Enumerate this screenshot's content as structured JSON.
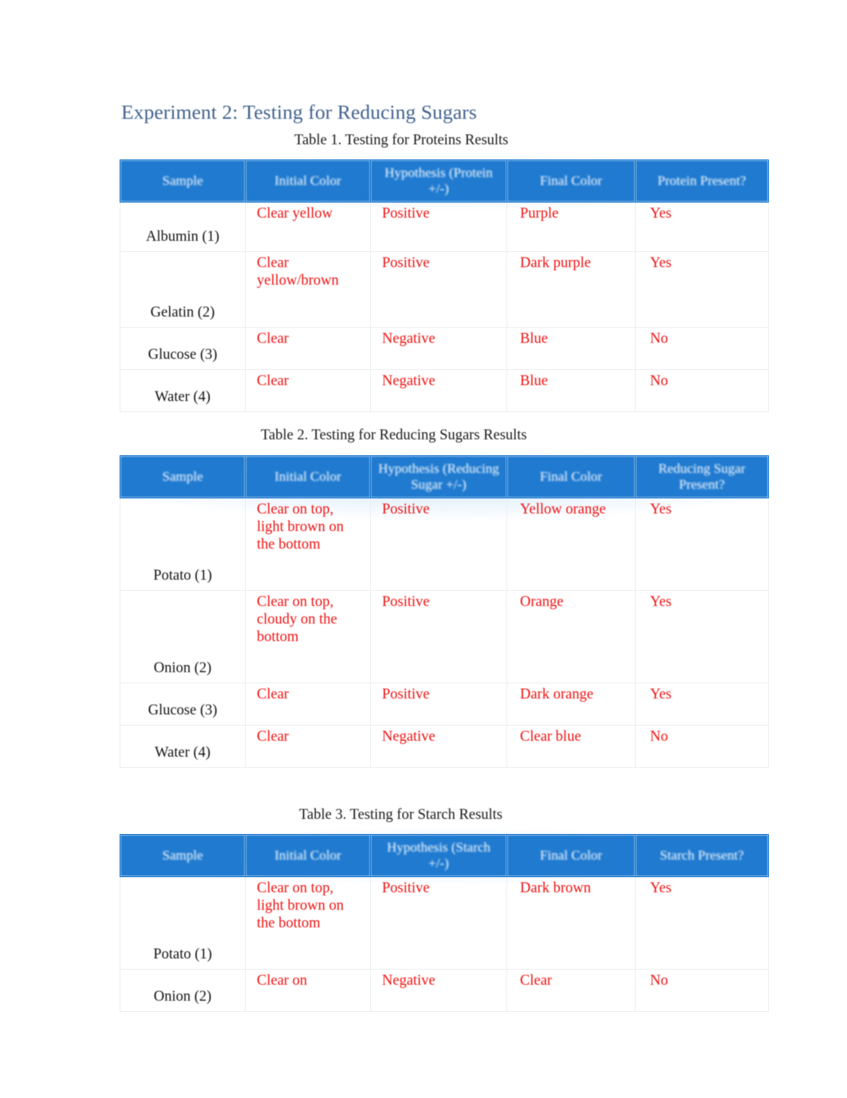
{
  "document": {
    "title": "Experiment 2: Testing for Reducing Sugars",
    "title_color": "#41628f",
    "header_bg_color": "#1f7ad0",
    "value_text_color": "#ee1111",
    "sample_text_color": "#131313"
  },
  "tables": [
    {
      "caption": "Table 1. Testing for Proteins Results",
      "headers": [
        "Sample",
        "Initial Color",
        "Hypothesis (Protein +/-)",
        "Final Color",
        "Protein Present?"
      ],
      "rows": [
        {
          "sample": "Albumin (1)",
          "initial_color": "Clear yellow",
          "hypothesis": "Positive",
          "final_color": "Purple",
          "present": "Yes"
        },
        {
          "sample": "Gelatin (2)",
          "initial_color": "Clear yellow/brown",
          "hypothesis": "Positive",
          "final_color": "Dark purple",
          "present": "Yes"
        },
        {
          "sample": "Glucose (3)",
          "initial_color": "Clear",
          "hypothesis": "Negative",
          "final_color": "Blue",
          "present": "No"
        },
        {
          "sample": "Water (4)",
          "initial_color": "Clear",
          "hypothesis": "Negative",
          "final_color": "Blue",
          "present": "No"
        }
      ]
    },
    {
      "caption": "Table 2. Testing for Reducing Sugars Results",
      "headers": [
        "Sample",
        "Initial Color",
        "Hypothesis (Reducing Sugar +/-)",
        "Final Color",
        "Reducing Sugar Present?"
      ],
      "rows": [
        {
          "sample": "Potato (1)",
          "initial_color": "Clear on top, light brown on the bottom",
          "hypothesis": "Positive",
          "final_color": "Yellow orange",
          "present": "Yes"
        },
        {
          "sample": "Onion (2)",
          "initial_color": "Clear on top, cloudy on the bottom",
          "hypothesis": "Positive",
          "final_color": "Orange",
          "present": "Yes"
        },
        {
          "sample": "Glucose (3)",
          "initial_color": "Clear",
          "hypothesis": "Positive",
          "final_color": "Dark orange",
          "present": "Yes"
        },
        {
          "sample": "Water (4)",
          "initial_color": "Clear",
          "hypothesis": "Negative",
          "final_color": "Clear blue",
          "present": "No"
        }
      ]
    },
    {
      "caption": "Table 3. Testing for Starch Results",
      "headers": [
        "Sample",
        "Initial Color",
        "Hypothesis (Starch +/-)",
        "Final Color",
        "Starch Present?"
      ],
      "rows": [
        {
          "sample": "Potato (1)",
          "initial_color": "Clear on top, light brown on the bottom",
          "hypothesis": "Positive",
          "final_color": "Dark brown",
          "present": "Yes"
        },
        {
          "sample": "Onion (2)",
          "initial_color": "Clear on",
          "hypothesis": "Negative",
          "final_color": "Clear",
          "present": "No"
        }
      ]
    }
  ]
}
